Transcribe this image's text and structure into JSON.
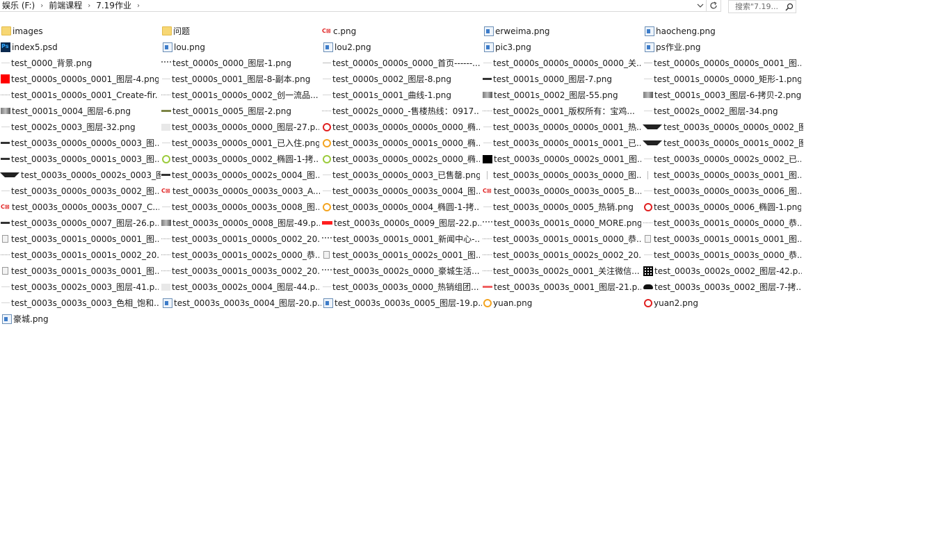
{
  "breadcrumb": {
    "drive": "娱乐 (F:)",
    "folder1": "前端课程",
    "folder2": "7.19作业",
    "separator": "›"
  },
  "search": {
    "placeholder": "搜索\"7.19..."
  },
  "icons": {
    "dropdown": "chevron-down-icon",
    "refresh": "refresh-icon",
    "search": "search-icon"
  },
  "files": [
    {
      "name": "images",
      "icon": "folder"
    },
    {
      "name": "问题",
      "icon": "folder"
    },
    {
      "name": "c.png",
      "icon": "logo-red"
    },
    {
      "name": "erweima.png",
      "icon": "img"
    },
    {
      "name": "haocheng.png",
      "icon": "img"
    },
    {
      "name": "index5.psd",
      "icon": "psd"
    },
    {
      "name": "lou.png",
      "icon": "img"
    },
    {
      "name": "lou2.png",
      "icon": "img"
    },
    {
      "name": "pic3.png",
      "icon": "img"
    },
    {
      "name": "ps作业.png",
      "icon": "img"
    },
    {
      "name": "test_0000_背景.png",
      "icon": "thin"
    },
    {
      "name": "test_0000s_0000_图层-1.png",
      "icon": "wave"
    },
    {
      "name": "test_0000s_0000s_0000_首页------...",
      "icon": "hl"
    },
    {
      "name": "test_0000s_0000s_0000s_0000_关...",
      "icon": "thin"
    },
    {
      "name": "test_0000s_0000s_0000s_0001_图...",
      "icon": "hl"
    },
    {
      "name": "test_0000s_0000s_0001_图层-4.png",
      "icon": "red"
    },
    {
      "name": "test_0000s_0001_图层-8-副本.png",
      "icon": "thin"
    },
    {
      "name": "test_0000s_0002_图层-8.png",
      "icon": "thin"
    },
    {
      "name": "test_0001s_0000_图层-7.png",
      "icon": "bar"
    },
    {
      "name": "test_0001s_0000s_0000_矩形-1.png",
      "icon": "thin"
    },
    {
      "name": "test_0001s_0000s_0001_Create-fir...",
      "icon": "dotted"
    },
    {
      "name": "test_0001s_0000s_0002_创一流品...",
      "icon": "dotted"
    },
    {
      "name": "test_0001s_0001_曲线-1.png",
      "icon": "thin"
    },
    {
      "name": "test_0001s_0002_图层-55.png",
      "icon": "gray-photo"
    },
    {
      "name": "test_0001s_0003_图层-6-拷贝-2.png",
      "icon": "gray-photo"
    },
    {
      "name": "test_0001s_0004_图层-6.png",
      "icon": "gray-photo"
    },
    {
      "name": "test_0001s_0005_图层-2.png",
      "icon": "bar-olive"
    },
    {
      "name": "test_0002s_0000_-售楼热线：0917...",
      "icon": "dotted"
    },
    {
      "name": "test_0002s_0001_版权所有：宝鸡...",
      "icon": "dotted"
    },
    {
      "name": "test_0002s_0002_图层-34.png",
      "icon": "thin"
    },
    {
      "name": "test_0002s_0003_图层-32.png",
      "icon": "thin"
    },
    {
      "name": "test_0003s_0000s_0000_图层-27.p...",
      "icon": "light-grey"
    },
    {
      "name": "test_0003s_0000s_0000s_0000_椭...",
      "icon": "ring-red"
    },
    {
      "name": "test_0003s_0000s_0000s_0001_热...",
      "icon": "thin"
    },
    {
      "name": "test_0003s_0000s_0000s_0002_图...",
      "icon": "triangle"
    },
    {
      "name": "test_0003s_0000s_0000s_0003_图...",
      "icon": "bar"
    },
    {
      "name": "test_0003s_0000s_0001_已入住.png",
      "icon": "thin"
    },
    {
      "name": "test_0003s_0000s_0001s_0000_椭...",
      "icon": "ring-orange"
    },
    {
      "name": "test_0003s_0000s_0001s_0001_已...",
      "icon": "thin"
    },
    {
      "name": "test_0003s_0000s_0001s_0002_图...",
      "icon": "triangle"
    },
    {
      "name": "test_0003s_0000s_0001s_0003_图...",
      "icon": "bar"
    },
    {
      "name": "test_0003s_0000s_0002_椭圆-1-拷...",
      "icon": "ring-green"
    },
    {
      "name": "test_0003s_0000s_0002s_0000_椭...",
      "icon": "ring-green"
    },
    {
      "name": "test_0003s_0000s_0002s_0001_图...",
      "icon": "black-sq"
    },
    {
      "name": "test_0003s_0000s_0002s_0002_已...",
      "icon": "thin"
    },
    {
      "name": "test_0003s_0000s_0002s_0003_图...",
      "icon": "triangle"
    },
    {
      "name": "test_0003s_0000s_0002s_0004_图...",
      "icon": "bar"
    },
    {
      "name": "test_0003s_0000s_0003_已售罄.png",
      "icon": "thin"
    },
    {
      "name": "test_0003s_0000s_0003s_0000_图...",
      "icon": "vline"
    },
    {
      "name": "test_0003s_0000s_0003s_0001_图...",
      "icon": "vline"
    },
    {
      "name": "test_0003s_0000s_0003s_0002_图...",
      "icon": "thin"
    },
    {
      "name": "test_0003s_0000s_0003s_0003_A...",
      "icon": "logo-red"
    },
    {
      "name": "test_0003s_0000s_0003s_0004_图...",
      "icon": "thin"
    },
    {
      "name": "test_0003s_0000s_0003s_0005_B...",
      "icon": "logo-red"
    },
    {
      "name": "test_0003s_0000s_0003s_0006_图...",
      "icon": "thin"
    },
    {
      "name": "test_0003s_0000s_0003s_0007_C...",
      "icon": "logo-red"
    },
    {
      "name": "test_0003s_0000s_0003s_0008_图...",
      "icon": "thin"
    },
    {
      "name": "test_0003s_0000s_0004_椭圆-1-拷...",
      "icon": "ring-orange"
    },
    {
      "name": "test_0003s_0000s_0005_热销.png",
      "icon": "thin"
    },
    {
      "name": "test_0003s_0000s_0006_椭圆-1.png",
      "icon": "ring-red"
    },
    {
      "name": "test_0003s_0000s_0007_图层-26.p...",
      "icon": "bar"
    },
    {
      "name": "test_0003s_0000s_0008_图层-49.p...",
      "icon": "gray-photo"
    },
    {
      "name": "test_0003s_0000s_0009_图层-22.p...",
      "icon": "red-bar"
    },
    {
      "name": "test_0003s_0001s_0000_MORE.png",
      "icon": "wave"
    },
    {
      "name": "test_0003s_0001s_0000s_0000_恭...",
      "icon": "dotted"
    },
    {
      "name": "test_0003s_0001s_0000s_0001_图...",
      "icon": "doc-small"
    },
    {
      "name": "test_0003s_0001s_0000s_0002_20...",
      "icon": "dotted"
    },
    {
      "name": "test_0003s_0001s_0001_新闻中心-...",
      "icon": "wave"
    },
    {
      "name": "test_0003s_0001s_0001s_0000_恭...",
      "icon": "dotted"
    },
    {
      "name": "test_0003s_0001s_0001s_0001_图...",
      "icon": "doc-small"
    },
    {
      "name": "test_0003s_0001s_0001s_0002_20...",
      "icon": "dotted"
    },
    {
      "name": "test_0003s_0001s_0002s_0000_恭...",
      "icon": "dotted"
    },
    {
      "name": "test_0003s_0001s_0002s_0001_图...",
      "icon": "doc-small"
    },
    {
      "name": "test_0003s_0001s_0002s_0002_20...",
      "icon": "dotted"
    },
    {
      "name": "test_0003s_0001s_0003s_0000_恭...",
      "icon": "thin"
    },
    {
      "name": "test_0003s_0001s_0003s_0001_图...",
      "icon": "doc-small"
    },
    {
      "name": "test_0003s_0001s_0003s_0002_20...",
      "icon": "dotted"
    },
    {
      "name": "test_0003s_0002s_0000_豪城生活...",
      "icon": "wave"
    },
    {
      "name": "test_0003s_0002s_0001_关注微信...",
      "icon": "dotted"
    },
    {
      "name": "test_0003s_0002s_0002_图层-42.p...",
      "icon": "qr"
    },
    {
      "name": "test_0003s_0002s_0003_图层-41.p...",
      "icon": "thin"
    },
    {
      "name": "test_0003s_0002s_0004_图层-44.p...",
      "icon": "light-grey"
    },
    {
      "name": "test_0003s_0003s_0000_热销组团....",
      "icon": "thin"
    },
    {
      "name": "test_0003s_0003s_0001_图层-21.p...",
      "icon": "pink-bar"
    },
    {
      "name": "test_0003s_0003s_0002_图层-7-拷...",
      "icon": "cloud"
    },
    {
      "name": "test_0003s_0003s_0003_色相_饱和...",
      "icon": "thin"
    },
    {
      "name": "test_0003s_0003s_0004_图层-20.p...",
      "icon": "img"
    },
    {
      "name": "test_0003s_0003s_0005_图层-19.p...",
      "icon": "img"
    },
    {
      "name": "yuan.png",
      "icon": "ring-orange"
    },
    {
      "name": "yuan2.png",
      "icon": "ring-red"
    },
    {
      "name": "豪城.png",
      "icon": "img"
    }
  ]
}
